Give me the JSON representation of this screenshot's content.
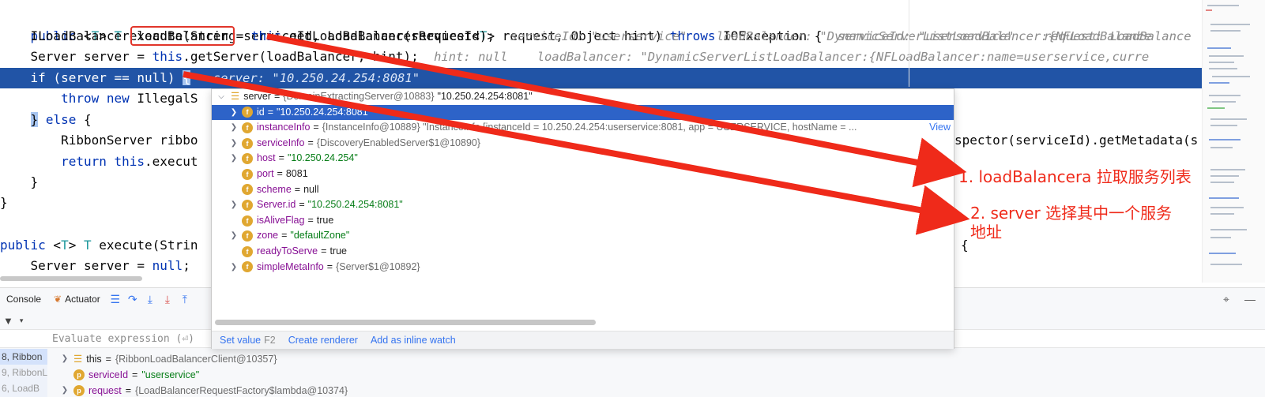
{
  "editor": {
    "lines": [
      {
        "text_a": "public <T> T execute(String serviceId, LoadBalancerRequest<T> request, Object hint) throws IOException {",
        "hint": "serviceId: \"userservice\"    request: LoadBalance"
      },
      {
        "indent": "    ILoadBalancer ",
        "boxed": "loadBalancer",
        "rest": " = this.getLoadBalancer(serviceId);",
        "hint": "serviceId: \"userservice\"    loadBalancer: \"DynamicServerListLoadBalancer:{NFLoadBalance"
      },
      {
        "text": "    Server server = this.getServer(loadBalancer, hint);",
        "hint": "hint: null    loadBalancer: \"DynamicServerListLoadBalancer:{NFLoadBalancer:name=userservice,curre"
      },
      {
        "text": "    if (server == null) {",
        "hint": "server: \"10.250.24.254:8081\""
      },
      {
        "text": "        throw new IllegalS"
      },
      {
        "text": "    } else {"
      },
      {
        "text": "        RibbonServer ribbo",
        "tail": "spector(serviceId).getMetadata(s"
      },
      {
        "text": "        return this.execut"
      },
      {
        "text": "    }"
      },
      {
        "text": "}"
      },
      {
        "text": ""
      },
      {
        "text": "public <T> T execute(Strin",
        "tail": "{"
      },
      {
        "text": "    Server server = null;"
      }
    ]
  },
  "popup": {
    "header": {
      "name": "server",
      "type": "{DomainExtractingServer@10883}",
      "value": "\"10.250.24.254:8081\""
    },
    "rows": [
      {
        "name": "id",
        "value": "\"10.250.24.254:8081\"",
        "kind": "s",
        "expandable": true
      },
      {
        "name": "instanceInfo",
        "value": "{InstanceInfo@10889} \"InstanceInfo [instanceId = 10.250.24.254:userservice:8081, app = USERSERVICE, hostName = ...",
        "kind": "o",
        "expandable": true,
        "link": "View"
      },
      {
        "name": "serviceInfo",
        "value": "{DiscoveryEnabledServer$1@10890}",
        "kind": "o",
        "expandable": true
      },
      {
        "name": "host",
        "value": "\"10.250.24.254\"",
        "kind": "s",
        "expandable": true
      },
      {
        "name": "port",
        "value": "8081",
        "kind": "n",
        "expandable": false
      },
      {
        "name": "scheme",
        "value": "null",
        "kind": "n",
        "expandable": false
      },
      {
        "name": "Server.id",
        "value": "\"10.250.24.254:8081\"",
        "kind": "s",
        "expandable": true
      },
      {
        "name": "isAliveFlag",
        "value": "true",
        "kind": "n",
        "expandable": false
      },
      {
        "name": "zone",
        "value": "\"defaultZone\"",
        "kind": "s",
        "expandable": true
      },
      {
        "name": "readyToServe",
        "value": "true",
        "kind": "n",
        "expandable": false
      },
      {
        "name": "simpleMetaInfo",
        "value": "{Server$1@10892}",
        "kind": "o",
        "expandable": true
      }
    ],
    "footer": {
      "set_value": "Set value",
      "set_value_key": "F2",
      "create_renderer": "Create renderer",
      "add_watch": "Add as inline watch"
    }
  },
  "debug": {
    "tabs": {
      "console": "Console",
      "actuator": "Actuator"
    },
    "eval_placeholder": "Evaluate expression (⏎)",
    "frames": [
      "8, Ribbon",
      "9, RibbonL",
      "6, LoadB"
    ],
    "variables": [
      {
        "name": "this",
        "value": "{RibbonLoadBalancerClient@10357}",
        "icon": "list"
      },
      {
        "name": "serviceId",
        "value": "\"userservice\"",
        "icon": "p"
      },
      {
        "name": "request",
        "value": "{LoadBalancerRequestFactory$lambda@10374}",
        "icon": "p"
      }
    ]
  },
  "annotations": {
    "note1": "1. loadBalancera 拉取服务列表",
    "note2_line1": "2. server 选择其中一个服务",
    "note2_line2": "地址"
  },
  "colors": {
    "arrow": "#ef2a1a",
    "selection": "#2154a6"
  }
}
